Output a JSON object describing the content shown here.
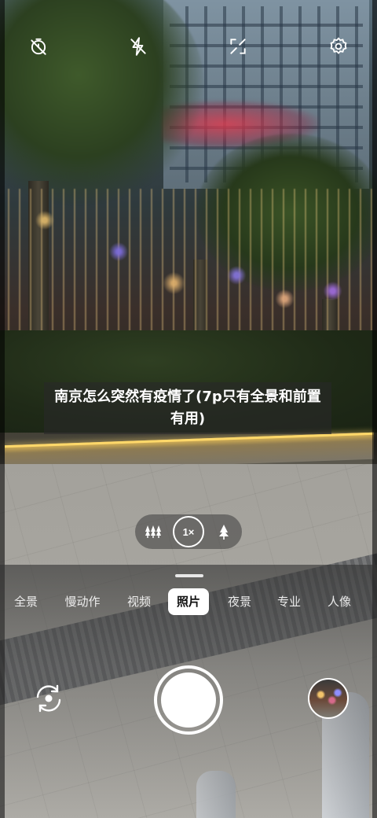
{
  "caption": {
    "text": "南京怎么突然有疫情了(7p只有全景和前置有用)"
  },
  "top_bar": {
    "icons": [
      "timer-off-icon",
      "flash-off-icon",
      "fullscreen-icon",
      "settings-icon"
    ]
  },
  "zoom": {
    "level": "1×",
    "wide_icon": "trees-icon",
    "tele_icon": "tree-icon"
  },
  "modes": {
    "items": [
      "全景",
      "慢动作",
      "视频",
      "照片",
      "夜景",
      "专业",
      "人像"
    ],
    "selected": "照片"
  },
  "controls": {
    "switch_camera_icon": "camera-switch-icon",
    "shutter_icon": "shutter-button",
    "gallery_icon": "gallery-thumbnail"
  },
  "colors": {
    "accent": "#ffffff",
    "mode_active_bg": "#ffffff",
    "mode_active_text": "#111111"
  }
}
